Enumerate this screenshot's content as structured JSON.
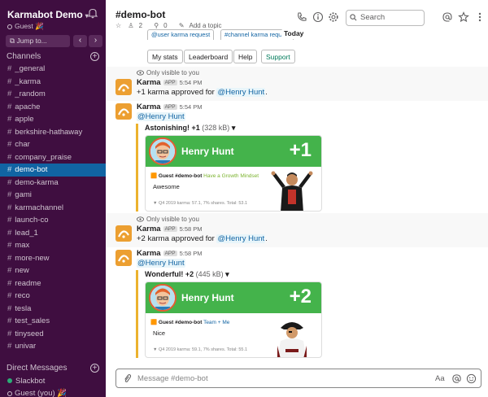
{
  "sidebar": {
    "workspace": "Karmabot Demo",
    "user": "Guest",
    "user_emoji": "🎉",
    "jump_to": "Jump to...",
    "channels_heading": "Channels",
    "channels": [
      "_general",
      "_karma",
      "_random",
      "apache",
      "apple",
      "berkshire-hathaway",
      "char",
      "company_praise",
      "demo-bot",
      "demo-karma",
      "gami",
      "karmachannel",
      "launch-co",
      "lead_1",
      "max",
      "more-new",
      "new",
      "readme",
      "reco",
      "tesla",
      "test_sales",
      "tinyseed",
      "univar"
    ],
    "active_channel": "demo-bot",
    "dm_heading": "Direct Messages",
    "dms": [
      {
        "name": "Slackbot"
      },
      {
        "name": "Guest",
        "suffix": "(you)",
        "emoji": "🎉"
      }
    ]
  },
  "header": {
    "channel": "#demo-bot",
    "members": "2",
    "pins": "0",
    "add_topic": "Add a topic",
    "search_placeholder": "Search",
    "date_divider": "Today"
  },
  "quick_tags": [
    "@user karma request",
    "#channel karma request"
  ],
  "action_buttons": [
    "My stats",
    "Leaderboard",
    "Help",
    "Support"
  ],
  "messages": [
    {
      "only_visible": "Only visible to you",
      "sender": "Karma",
      "badge": "APP",
      "time": "5:54 PM",
      "text": "+1 karma approved for ",
      "mention": "@Henry Hunt",
      "end": "."
    },
    {
      "sender": "Karma",
      "badge": "APP",
      "time": "5:54 PM",
      "mention": "@Henry Hunt",
      "attachment": {
        "title": "Astonishing! +1",
        "size": "(328 kB)",
        "card_name": "Henry Hunt",
        "card_points": "+1",
        "sub_from": "Guest #demo-bot",
        "sub_link": "Have a Growth Mindset",
        "message": "Awesome",
        "footer": "Q4 2019 karma: 57.1, 7% shares. Total: 53.1"
      }
    },
    {
      "only_visible": "Only visible to you",
      "sender": "Karma",
      "badge": "APP",
      "time": "5:58 PM",
      "text": "+2 karma approved for ",
      "mention": "@Henry Hunt",
      "end": "."
    },
    {
      "sender": "Karma",
      "badge": "APP",
      "time": "5:58 PM",
      "mention": "@Henry Hunt",
      "attachment": {
        "title": "Wonderful! +2",
        "size": "(445 kB)",
        "card_name": "Henry Hunt",
        "card_points": "+2",
        "sub_from": "Guest #demo-bot",
        "sub_link": "Team + Me",
        "message": "Nice",
        "footer": "Q4 2019 karma: 59.1, 7% shares. Total: 55.1"
      }
    }
  ],
  "composer": {
    "placeholder": "Message #demo-bot",
    "format_label": "Aa"
  }
}
